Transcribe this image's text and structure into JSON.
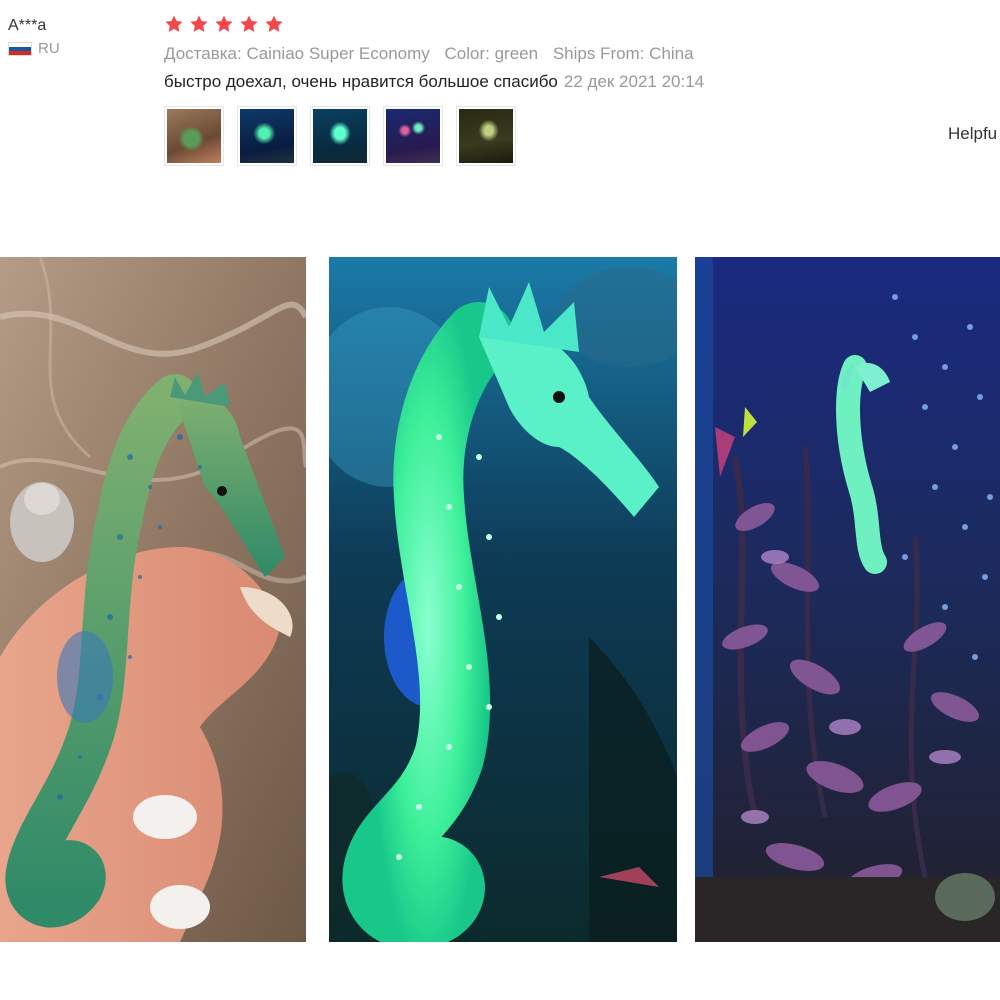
{
  "reviewer": {
    "name": "A***a",
    "country": "RU",
    "flag_colors": [
      "#ffffff",
      "#1c57a5",
      "#d52b1e"
    ]
  },
  "review": {
    "rating": 5,
    "rating_color": "#f5474a",
    "delivery": "Доставка: Cainiao Super Economy",
    "color": "Color: green",
    "ships_from": "Ships From: China",
    "text": "быстро доехал, очень нравится большое спасибо",
    "date": "22 дек 2021 20:14",
    "thumbnails": [
      {
        "name": "photo-hand-seahorse",
        "colors": [
          "#8a6a4c",
          "#4a8a5a"
        ]
      },
      {
        "name": "photo-glowing-seahorse-closeup",
        "colors": [
          "#0c2a55",
          "#3fe0a0"
        ]
      },
      {
        "name": "photo-glowing-seahorse-cyan",
        "colors": [
          "#083050",
          "#40f0c0"
        ]
      },
      {
        "name": "photo-aquarium-tank",
        "colors": [
          "#102050",
          "#8060a0"
        ]
      },
      {
        "name": "photo-aquarium-dark",
        "colors": [
          "#202010",
          "#90a060"
        ]
      }
    ]
  },
  "actions": {
    "helpful": "Helpfu"
  },
  "gallery": {
    "photos": [
      {
        "name": "photo-seahorse-in-hand",
        "palette": "warm"
      },
      {
        "name": "photo-seahorse-glowing-tank",
        "palette": "glow"
      },
      {
        "name": "photo-seahorse-aquarium-plants",
        "palette": "aquarium"
      }
    ]
  }
}
